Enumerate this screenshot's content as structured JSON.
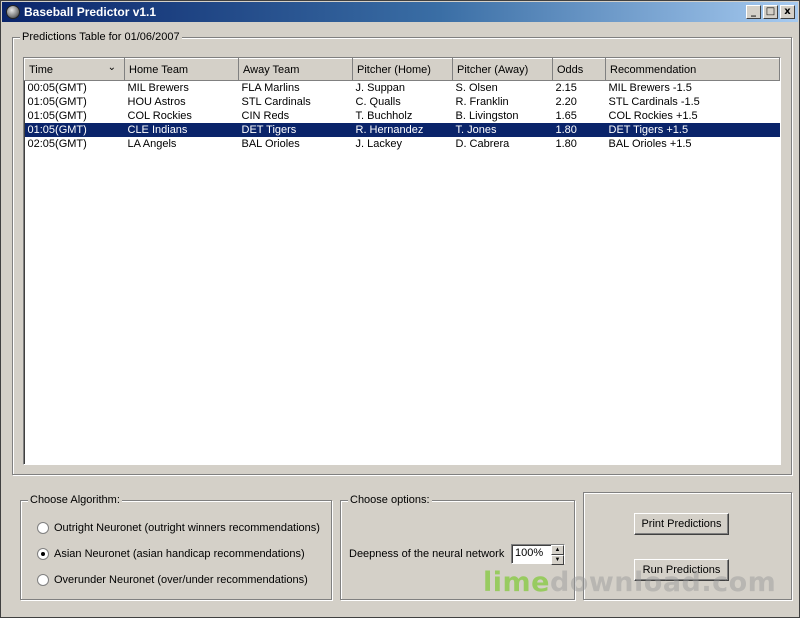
{
  "window": {
    "title": "Baseball Predictor v1.1",
    "controls": {
      "minimize": "_",
      "maximize": "□",
      "close": "x"
    }
  },
  "predictions": {
    "legend": "Predictions Table for 01/06/2007",
    "columns": [
      "Time",
      "Home Team",
      "Away Team",
      "Pitcher (Home)",
      "Pitcher (Away)",
      "Odds",
      "Recommendation"
    ],
    "rows": [
      [
        "00:05(GMT)",
        "MIL Brewers",
        "FLA Marlins",
        "J. Suppan",
        "S. Olsen",
        "2.15",
        "MIL Brewers -1.5"
      ],
      [
        "01:05(GMT)",
        "HOU Astros",
        "STL Cardinals",
        "C. Qualls",
        "R. Franklin",
        "2.20",
        "STL Cardinals -1.5"
      ],
      [
        "01:05(GMT)",
        "COL Rockies",
        "CIN Reds",
        "T. Buchholz",
        "B. Livingston",
        "1.65",
        "COL Rockies +1.5"
      ],
      [
        "01:05(GMT)",
        "CLE Indians",
        "DET Tigers",
        "R. Hernandez",
        "T. Jones",
        "1.80",
        "DET Tigers +1.5"
      ],
      [
        "02:05(GMT)",
        "LA Angels",
        "BAL Orioles",
        "J. Lackey",
        "D. Cabrera",
        "1.80",
        "BAL Orioles +1.5"
      ]
    ],
    "selected_row": 3
  },
  "algorithm": {
    "legend": "Choose Algorithm:",
    "options": [
      {
        "label": "Outright Neuronet  (outright winners recommendations)",
        "checked": false
      },
      {
        "label": "Asian Neuronet  (asian handicap recommendations)",
        "checked": true
      },
      {
        "label": "Overunder Neuronet  (over/under recommendations)",
        "checked": false
      }
    ]
  },
  "options": {
    "legend": "Choose options:",
    "depth_label": "Deepness of the neural network",
    "depth_value": "100%"
  },
  "actions": {
    "print_label": "Print Predictions",
    "run_label": "Run Predictions"
  },
  "watermark": {
    "brand": "lime",
    "rest": "download.com"
  },
  "colors": {
    "selection": "#0a246a",
    "titlebar_start": "#0a246a",
    "titlebar_end": "#a6caf0",
    "face": "#d4d0c8"
  }
}
